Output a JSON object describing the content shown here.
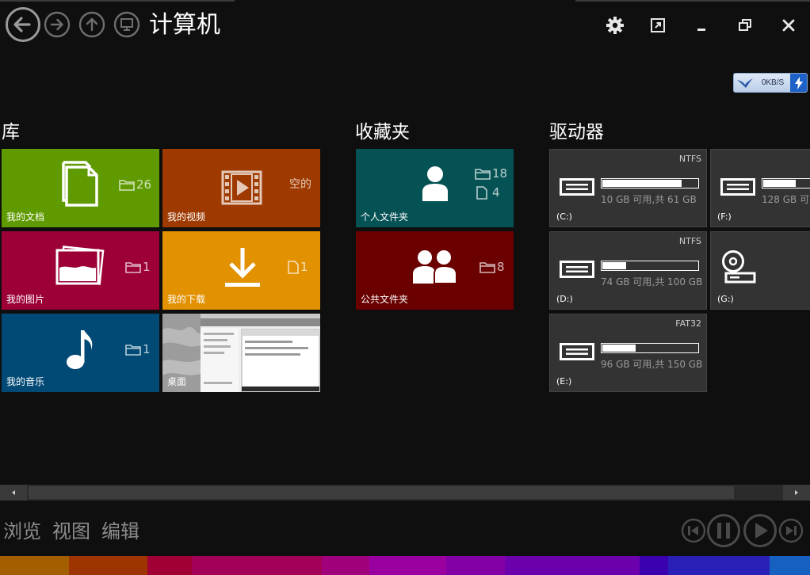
{
  "window": {
    "title": "计算机"
  },
  "nav": {
    "back": "back-arrow-icon",
    "forward": "forward-arrow-icon",
    "up": "up-arrow-icon",
    "computer": "monitor-icon"
  },
  "speed": {
    "text": "0KB/S"
  },
  "sections": {
    "library": "库",
    "favorites": "收藏夹",
    "drives": "驱动器"
  },
  "library": [
    {
      "label": "我的文档",
      "count": "26",
      "color": "#5e9a00",
      "icon": "documents-icon",
      "count_icon": "folder-icon"
    },
    {
      "label": "我的视频",
      "count": "空的",
      "color": "#9e3a00",
      "icon": "film-icon",
      "count_icon": ""
    },
    {
      "label": "我的图片",
      "count": "1",
      "color": "#9c0037",
      "icon": "pictures-icon",
      "count_icon": "folder-icon"
    },
    {
      "label": "我的下载",
      "count": "1",
      "color": "#e29100",
      "icon": "download-icon",
      "count_icon": "file-icon"
    },
    {
      "label": "我的音乐",
      "count": "1",
      "color": "#014a76",
      "icon": "music-note-icon",
      "count_icon": "folder-icon"
    },
    {
      "label": "桌面",
      "count": "",
      "color": "#7a7a7a",
      "icon": "desktop-thumbnail",
      "count_icon": ""
    }
  ],
  "favorites": [
    {
      "label": "个人文件夹",
      "folders": "18",
      "files": "4",
      "color": "#055255",
      "icon": "person-icon"
    },
    {
      "label": "公共文件夹",
      "folders": "8",
      "color": "#6a0000",
      "icon": "people-icon"
    }
  ],
  "drives": [
    {
      "letter": "(C:)",
      "fs": "NTFS",
      "space": "10 GB 可用,共 61 GB",
      "used_fraction": 0.84
    },
    {
      "letter": "(F:)",
      "fs": "",
      "space": "128 GB 可用",
      "used_fraction": 0.35
    },
    {
      "letter": "(D:)",
      "fs": "NTFS",
      "space": "74 GB 可用,共 100 GB",
      "used_fraction": 0.26
    },
    {
      "letter": "(G:)",
      "fs": "",
      "space": "",
      "used_fraction": null
    },
    {
      "letter": "(E:)",
      "fs": "FAT32",
      "space": "96 GB 可用,共 150 GB",
      "used_fraction": 0.36
    }
  ],
  "tabs": [
    "浏览",
    "视图",
    "编辑"
  ],
  "active_tab": 0,
  "strip_colors": [
    "#a35e00",
    "#9e3400",
    "#a10035",
    "#a30058",
    "#a0007c",
    "#9a00a0",
    "#8300a6",
    "#6c00ad",
    "#3b00b0",
    "#2a1fb6",
    "#1660c0"
  ]
}
